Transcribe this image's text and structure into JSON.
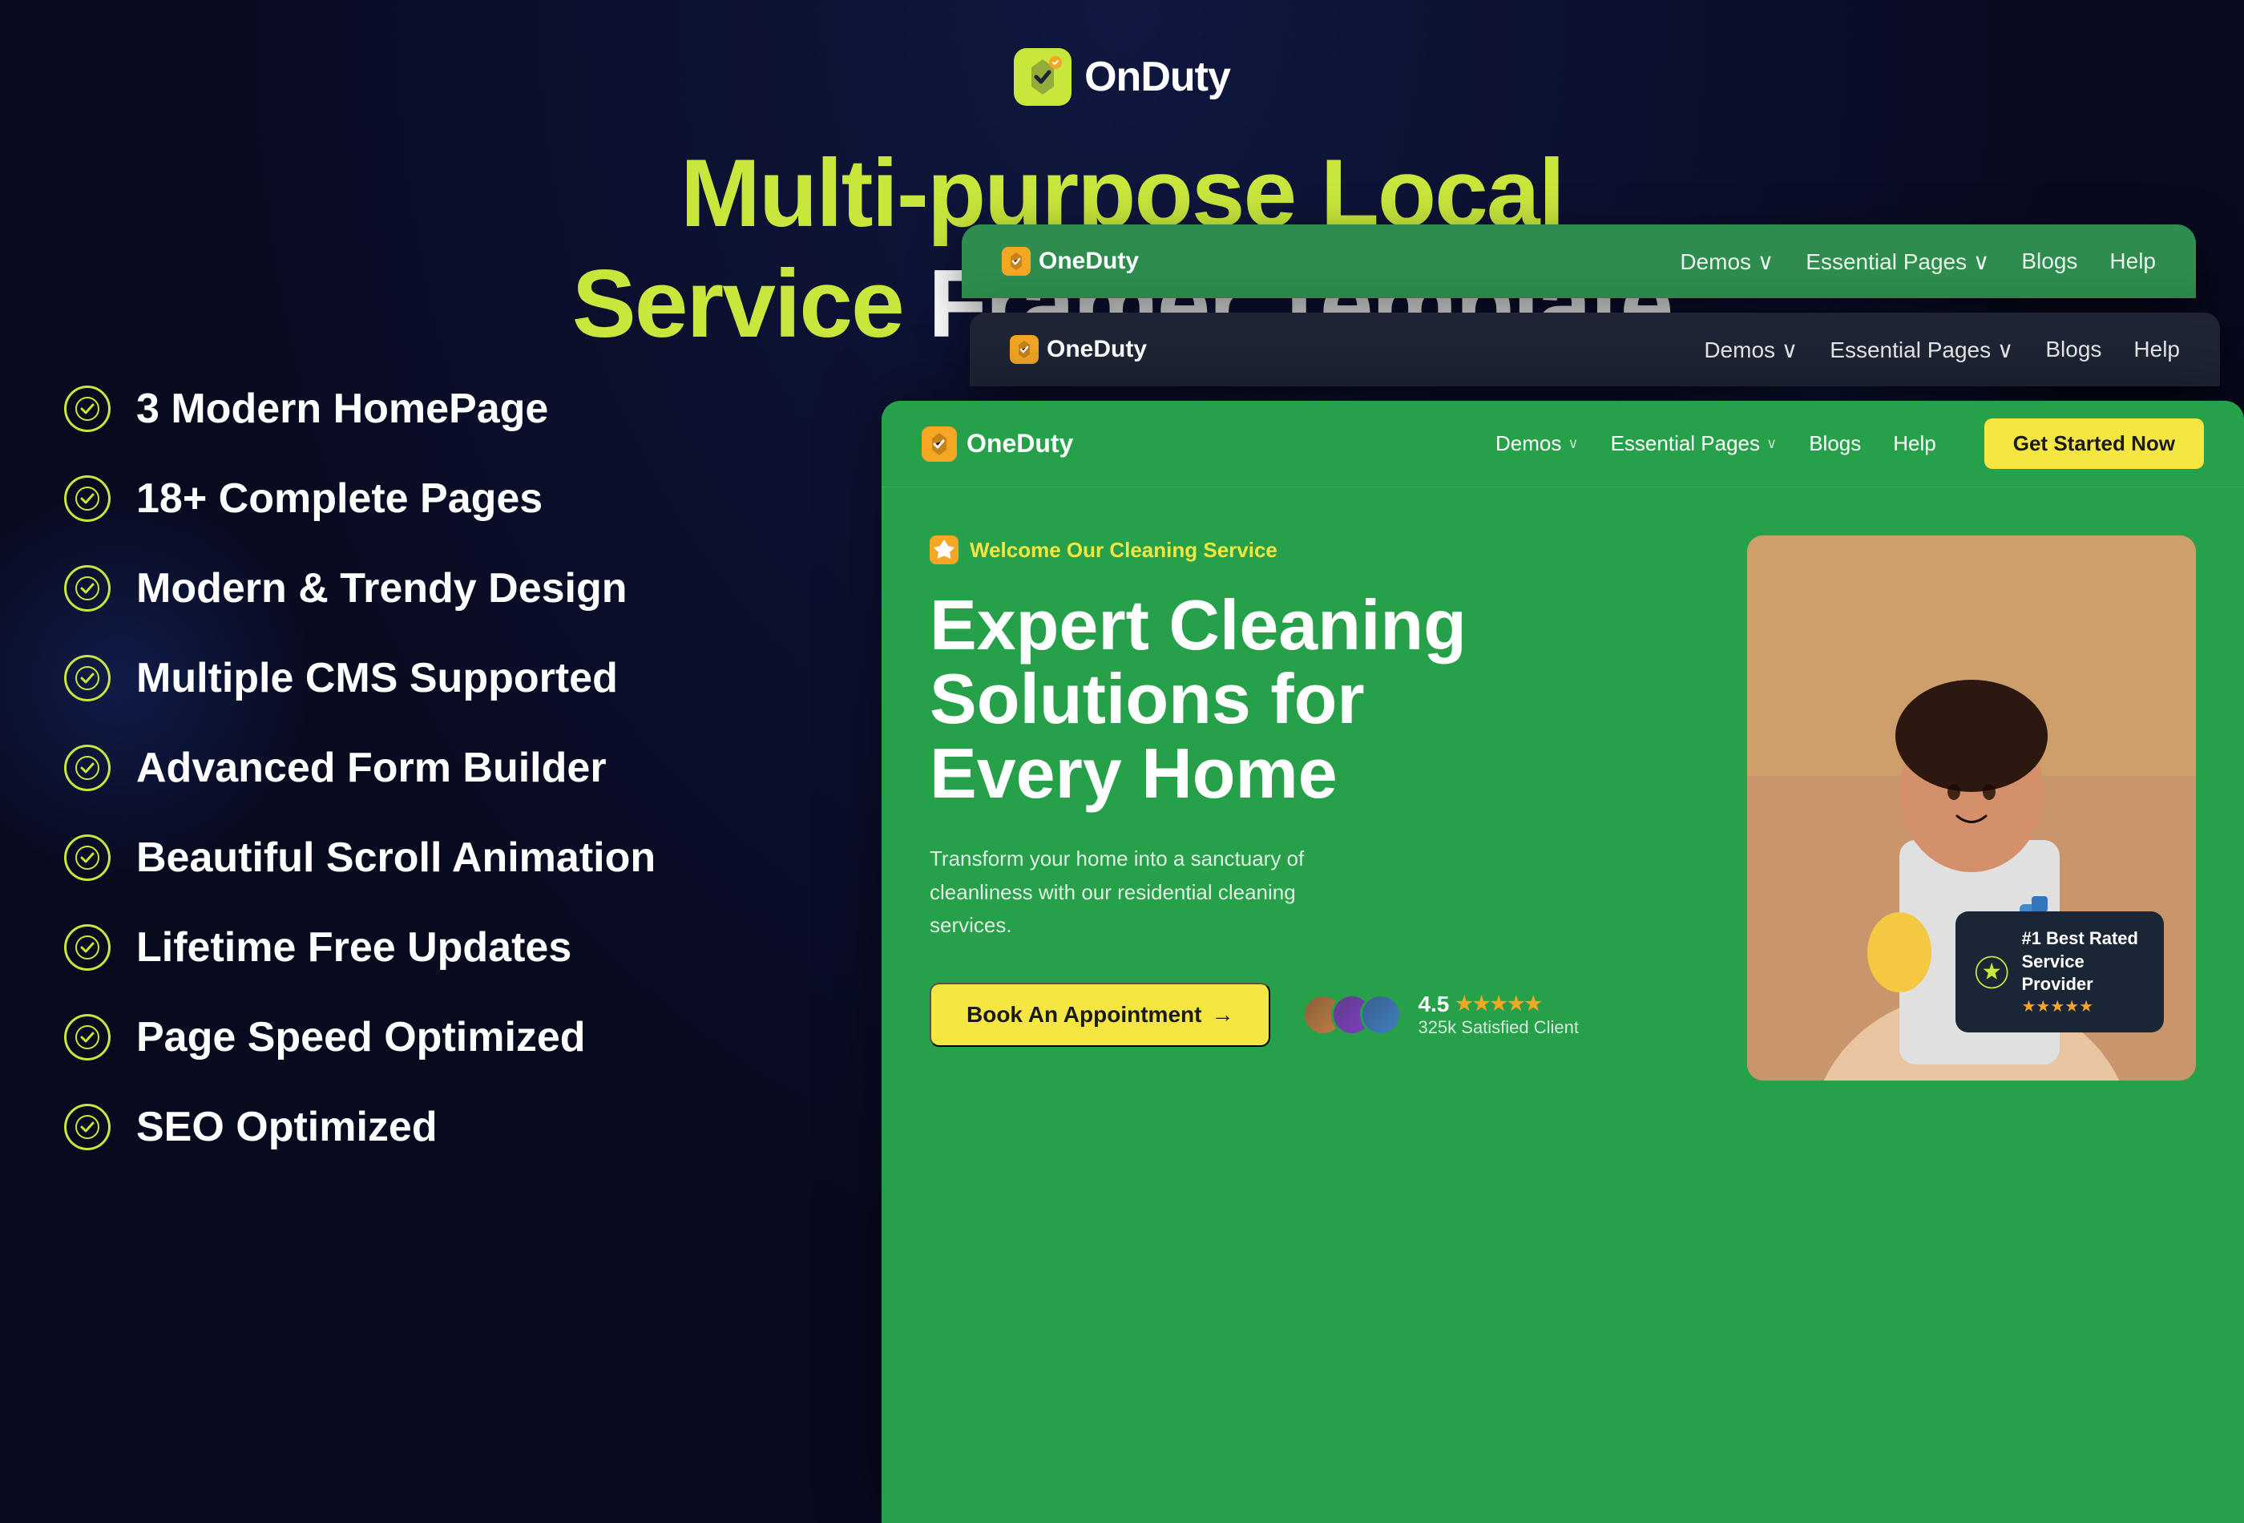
{
  "brand": {
    "logo_text": "OnDuty",
    "logo_icon_label": "onduty-icon"
  },
  "hero": {
    "title_line1": "Multi-purpose Local",
    "title_line2_green": "Service",
    "title_line2_white": "Framer Template"
  },
  "features": [
    {
      "id": 1,
      "text": "3 Modern HomePage"
    },
    {
      "id": 2,
      "text": "18+ Complete Pages"
    },
    {
      "id": 3,
      "text": "Modern & Trendy Design"
    },
    {
      "id": 4,
      "text": "Multiple CMS Supported"
    },
    {
      "id": 5,
      "text": "Advanced Form Builder"
    },
    {
      "id": 6,
      "text": "Beautiful Scroll Animation"
    },
    {
      "id": 7,
      "text": "Lifetime Free Updates"
    },
    {
      "id": 8,
      "text": "Page Speed Optimized"
    },
    {
      "id": 9,
      "text": "SEO Optimized"
    }
  ],
  "mockup": {
    "nav1": {
      "logo": "OneDuty",
      "links": [
        "Demos",
        "Essential Pages",
        "Blogs",
        "Help"
      ]
    },
    "nav2": {
      "logo": "OneDuty",
      "links": [
        "Demos",
        "Essential Pages",
        "Blogs",
        "Help"
      ]
    },
    "nav_main": {
      "logo": "OneDuty",
      "links": [
        "Demos",
        "Essential Pages",
        "Blogs",
        "Help"
      ],
      "cta": "Get Started Now"
    },
    "hero": {
      "badge": "Welcome Our Cleaning Service",
      "title_line1": "Expert Cleaning",
      "title_line2": "Solutions for",
      "title_line3": "Every Home",
      "description": "Transform your home into a sanctuary of cleanliness with our residential cleaning services.",
      "cta_button": "Book An Appointment",
      "rating_score": "4.5",
      "rating_label": "325k Satisfied Client",
      "best_rated_line1": "#1 Best Rated",
      "best_rated_line2": "Service Provider"
    }
  },
  "colors": {
    "accent_yellow": "#c8e63c",
    "green_primary": "#27a04a",
    "green_dark": "#2d8c4e",
    "dark_navy": "#1e2535",
    "cta_yellow": "#f5e642",
    "star_orange": "#f5a623",
    "bg_dark": "#0a0e2a"
  }
}
